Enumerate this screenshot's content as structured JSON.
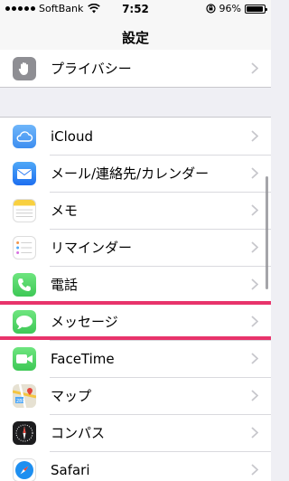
{
  "status_bar": {
    "carrier": "SoftBank",
    "time": "7:52",
    "battery": "96%",
    "battery_level": 0.96
  },
  "nav": {
    "title": "設定"
  },
  "section_privacy": [
    {
      "label": "プライバシー",
      "icon": "hand-icon",
      "color": "#8e8e93"
    }
  ],
  "section_apps": [
    {
      "label": "iCloud",
      "icon": "cloud-icon",
      "color": "#4f9cf2"
    },
    {
      "label": "メール/連絡先/カレンダー",
      "icon": "mail-icon",
      "color": "#2f7ef5"
    },
    {
      "label": "メモ",
      "icon": "notes-icon",
      "color": "#f8d040"
    },
    {
      "label": "リマインダー",
      "icon": "reminders-icon",
      "color": "#ffffff"
    },
    {
      "label": "電話",
      "icon": "phone-icon",
      "color": "#4cd964"
    },
    {
      "label": "メッセージ",
      "icon": "messages-icon",
      "color": "#4cd964"
    },
    {
      "label": "FaceTime",
      "icon": "facetime-icon",
      "color": "#4cd964"
    },
    {
      "label": "マップ",
      "icon": "maps-icon",
      "color": "#8ec7f0"
    },
    {
      "label": "コンパス",
      "icon": "compass-icon",
      "color": "#1c1c1e"
    },
    {
      "label": "Safari",
      "icon": "safari-icon",
      "color": "#1e8ff0"
    }
  ],
  "highlight_color": "#e8336b"
}
